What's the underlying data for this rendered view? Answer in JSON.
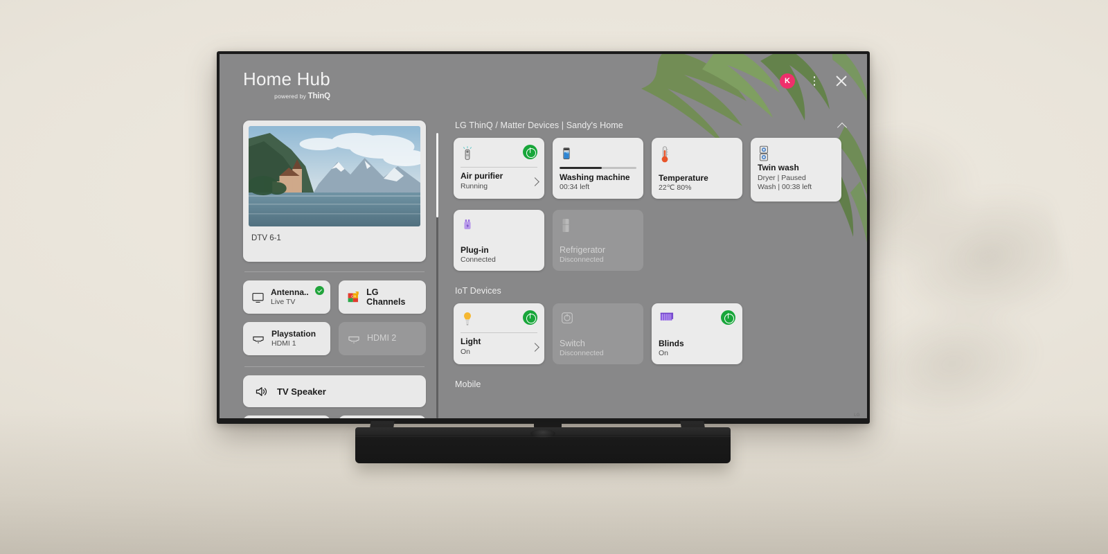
{
  "header": {
    "title": "Home Hub",
    "powered_by": "powered by",
    "brand": "ThinQ",
    "avatar_initial": "K",
    "avatar_color": "#ef2f6b",
    "menu_icon": "kebab-menu-icon",
    "close_icon": "close-icon"
  },
  "left_panel": {
    "preview": {
      "label": "DTV 6-1",
      "image_description": "lake with castle and snowy mountains"
    },
    "inputs": [
      {
        "name": "Antenna..",
        "sub": "Live TV",
        "icon": "tv-icon",
        "selected": true,
        "dimmed": false
      },
      {
        "name": "LG Channels",
        "sub": "",
        "icon": "lg-channels-icon",
        "selected": false,
        "dimmed": false
      },
      {
        "name": "Playstation",
        "sub": "HDMI 1",
        "icon": "hdmi-icon",
        "selected": false,
        "dimmed": false
      },
      {
        "name": "HDMI 2",
        "sub": "",
        "icon": "hdmi-icon",
        "selected": false,
        "dimmed": true
      }
    ],
    "audio": {
      "name": "TV Speaker",
      "icon": "speaker-icon"
    }
  },
  "right_panel": {
    "sections": [
      {
        "title": "LG ThinQ / Matter Devices | Sandy's Home",
        "collapse_icon": "chevron-up-icon",
        "rows": [
          [
            {
              "name": "Air purifier",
              "status": "Running",
              "icon": "air-purifier-icon",
              "power": true,
              "arrow": true,
              "divider": "line",
              "dimmed": false
            },
            {
              "name": "Washing machine",
              "status": "00:34 left",
              "icon": "washing-machine-icon",
              "power": false,
              "arrow": false,
              "divider": "progress",
              "progress": 55,
              "dimmed": false
            },
            {
              "name": "Temperature",
              "status": "22℃ 80%",
              "icon": "thermometer-icon",
              "power": false,
              "arrow": false,
              "divider": "none",
              "dimmed": false
            },
            {
              "name": "Twin wash",
              "status": "Dryer | Paused",
              "status2": "Wash | 00:38 left",
              "icon": "twin-wash-icon",
              "power": false,
              "arrow": false,
              "divider": "none",
              "dimmed": false
            }
          ],
          [
            {
              "name": "Plug-in",
              "status": "Connected",
              "icon": "plug-icon",
              "power": false,
              "arrow": false,
              "divider": "none",
              "dimmed": false
            },
            {
              "name": "Refrigerator",
              "status": "Disconnected",
              "icon": "refrigerator-icon",
              "power": false,
              "arrow": false,
              "divider": "none",
              "dimmed": true
            }
          ]
        ]
      },
      {
        "title": "IoT Devices",
        "rows": [
          [
            {
              "name": "Light",
              "status": "On",
              "icon": "bulb-icon",
              "power": true,
              "arrow": true,
              "divider": "line",
              "dimmed": false
            },
            {
              "name": "Switch",
              "status": "Disconnected",
              "icon": "switch-icon",
              "power": false,
              "arrow": false,
              "divider": "none",
              "dimmed": true
            },
            {
              "name": "Blinds",
              "status": "On",
              "icon": "blinds-icon",
              "power": true,
              "arrow": false,
              "divider": "none",
              "dimmed": false
            }
          ]
        ]
      },
      {
        "title": "Mobile",
        "rows": []
      }
    ]
  },
  "colors": {
    "screen_bg": "#888889",
    "card_bg": "#ebebeb",
    "power_on": "#18a63a",
    "check_green": "#21a43c"
  }
}
